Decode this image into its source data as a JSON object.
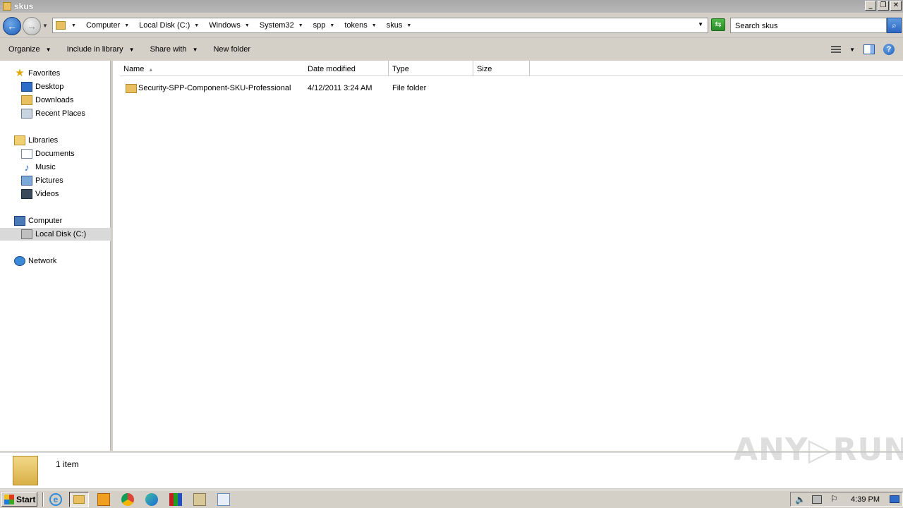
{
  "window": {
    "title": "skus",
    "minimize_label": "_",
    "restore_label": "❐",
    "close_label": "✕"
  },
  "navigation": {
    "back_label": "←",
    "forward_label": "→",
    "breadcrumb": [
      "Computer",
      "Local Disk (C:)",
      "Windows",
      "System32",
      "spp",
      "tokens",
      "skus"
    ],
    "search_placeholder": "Search skus"
  },
  "toolbar": {
    "organize": "Organize",
    "include_in_library": "Include in library",
    "share_with": "Share with",
    "new_folder": "New folder",
    "help_label": "?"
  },
  "sidebar": {
    "favorites": {
      "label": "Favorites",
      "items": [
        "Desktop",
        "Downloads",
        "Recent Places"
      ]
    },
    "libraries": {
      "label": "Libraries",
      "items": [
        "Documents",
        "Music",
        "Pictures",
        "Videos"
      ]
    },
    "computer": {
      "label": "Computer",
      "items": [
        "Local Disk (C:)"
      ]
    },
    "network": {
      "label": "Network"
    }
  },
  "file_list": {
    "columns": [
      "Name",
      "Date modified",
      "Type",
      "Size"
    ],
    "rows": [
      {
        "name": "Security-SPP-Component-SKU-Professional",
        "date_modified": "4/12/2011 3:24 AM",
        "type": "File folder",
        "size": ""
      }
    ]
  },
  "status_bar": {
    "item_count": "1 item"
  },
  "watermark": "ANY▷RUN",
  "taskbar": {
    "start_label": "Start",
    "clock": "4:39 PM"
  },
  "icons": {
    "accent": "#2f6bc8",
    "folder": "#e8c060"
  }
}
